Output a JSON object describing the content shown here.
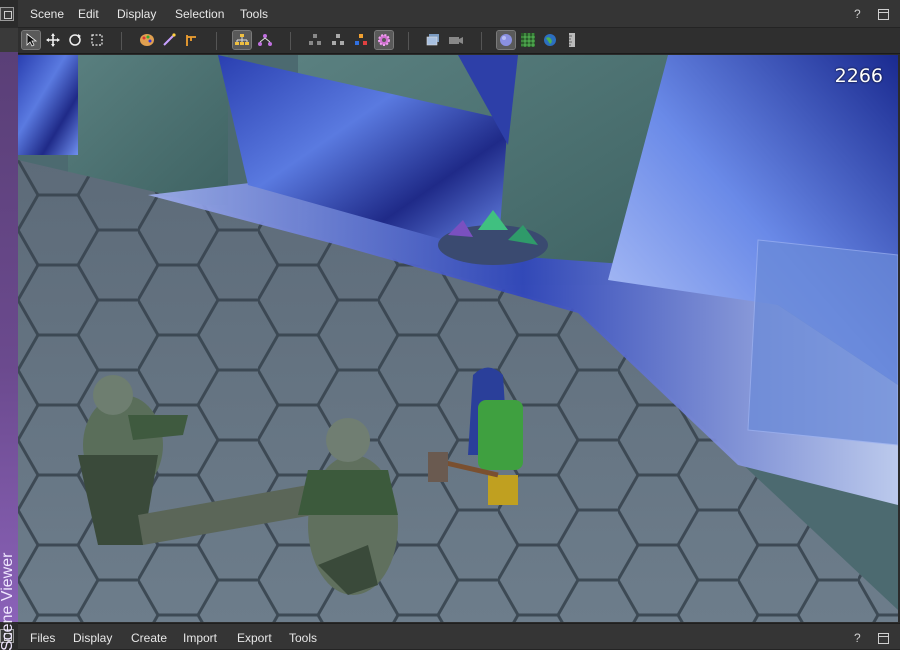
{
  "top_menu": {
    "items": [
      "Scene",
      "Edit",
      "Display",
      "Selection",
      "Tools"
    ],
    "help": "?"
  },
  "bottom_menu": {
    "items": [
      "Files",
      "Display",
      "Create",
      "Import",
      "Export",
      "Tools"
    ],
    "help": "?"
  },
  "side_tab": {
    "label": "Scene Viewer"
  },
  "viewport": {
    "counter": "2266"
  },
  "toolbar": {
    "tools": [
      "select-arrow-icon",
      "move-icon",
      "rotate-icon",
      "scale-box-icon",
      "palette-icon",
      "wand-icon",
      "measure-icon",
      "hierarchy-icon",
      "nodes-icon",
      "group-gray-icon",
      "group-gray2-icon",
      "group-color-icon",
      "gear-pink-icon",
      "layers-icon",
      "camera-icon",
      "sphere-icon",
      "grid-icon",
      "globe-icon",
      "ruler-icon"
    ]
  },
  "colors": {
    "purple_tab": "#6b4a8e",
    "menubar": "#353535",
    "crystal_blue": "#3a4fb8"
  }
}
